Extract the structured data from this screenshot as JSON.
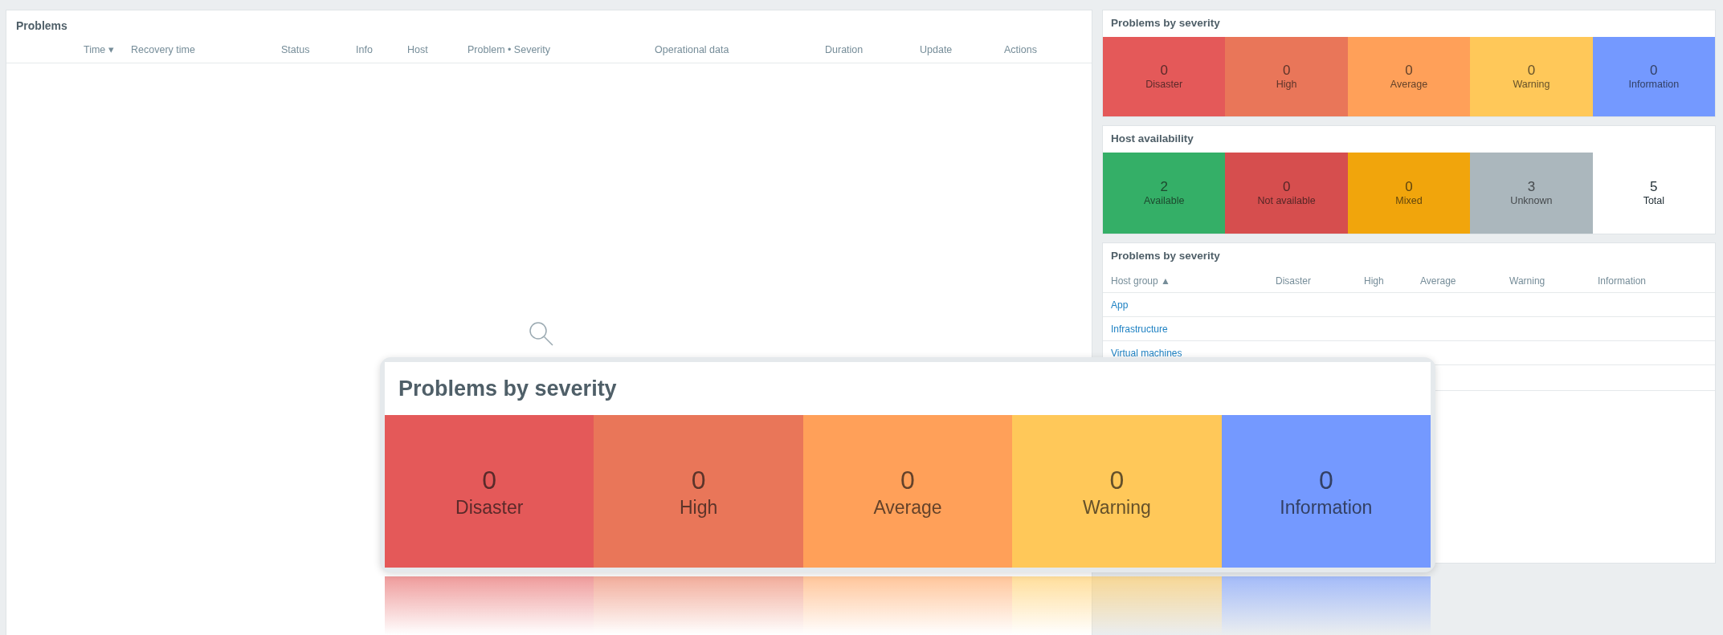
{
  "problems_widget": {
    "title": "Problems",
    "columns": [
      "Time ▾",
      "Recovery time",
      "Status",
      "Info",
      "Host",
      "Problem • Severity",
      "Operational data",
      "Duration",
      "Update",
      "Actions"
    ]
  },
  "severity_widget": {
    "title": "Problems by severity",
    "cells": [
      {
        "count": "0",
        "label": "Disaster",
        "color": "#e45959"
      },
      {
        "count": "0",
        "label": "High",
        "color": "#e97659"
      },
      {
        "count": "0",
        "label": "Average",
        "color": "#ffa059"
      },
      {
        "count": "0",
        "label": "Warning",
        "color": "#ffc859"
      },
      {
        "count": "0",
        "label": "Information",
        "color": "#7499ff"
      }
    ]
  },
  "host_availability_widget": {
    "title": "Host availability",
    "cells": [
      {
        "count": "2",
        "label": "Available",
        "color": "#34af67"
      },
      {
        "count": "0",
        "label": "Not available",
        "color": "#d64e4e"
      },
      {
        "count": "0",
        "label": "Mixed",
        "color": "#f1a50c"
      },
      {
        "count": "3",
        "label": "Unknown",
        "color": "#abb7bd"
      },
      {
        "count": "5",
        "label": "Total",
        "color": "#ffffff"
      }
    ]
  },
  "severity_table_widget": {
    "title": "Problems by severity",
    "columns": [
      "Host group ▲",
      "Disaster",
      "High",
      "Average",
      "Warning",
      "Information"
    ],
    "rows": [
      "App",
      "Infrastructure",
      "Virtual machines"
    ]
  },
  "magnified_callout": {
    "title": "Problems by severity",
    "cells": [
      {
        "count": "0",
        "label": "Disaster",
        "color": "#e45959"
      },
      {
        "count": "0",
        "label": "High",
        "color": "#e97659"
      },
      {
        "count": "0",
        "label": "Average",
        "color": "#ffa059"
      },
      {
        "count": "0",
        "label": "Warning",
        "color": "#ffc859"
      },
      {
        "count": "0",
        "label": "Information",
        "color": "#7499ff"
      }
    ]
  }
}
